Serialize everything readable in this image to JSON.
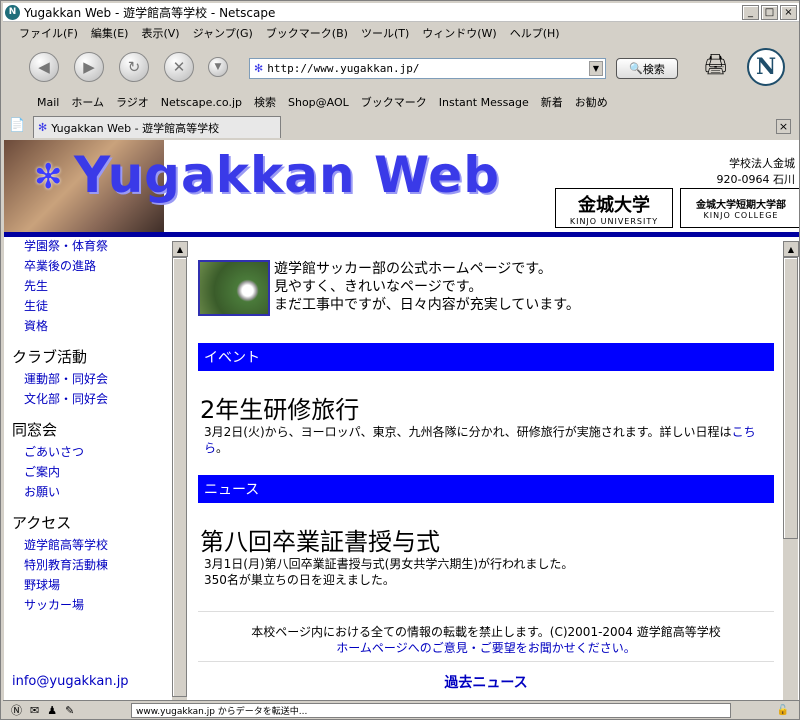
{
  "window": {
    "title": "Yugakkan Web - 遊学館高等学校 - Netscape"
  },
  "menu": [
    "ファイル(F)",
    "編集(E)",
    "表示(V)",
    "ジャンプ(G)",
    "ブックマーク(B)",
    "ツール(T)",
    "ウィンドウ(W)",
    "ヘルプ(H)"
  ],
  "nav": {
    "url": "http://www.yugakkan.jp/",
    "search_label": "検索"
  },
  "bookmarks": [
    "Mail",
    "ホーム",
    "ラジオ",
    "Netscape.co.jp",
    "検索",
    "Shop@AOL",
    "ブックマーク",
    "Instant Message",
    "新着",
    "お勧め"
  ],
  "tab": {
    "label": "Yugakkan Web - 遊学館高等学校"
  },
  "banner": {
    "title": "Yugakkan Web",
    "org": "学校法人金城",
    "postal": "920-0964 石川",
    "logo1_main": "金城大学",
    "logo1_sub": "KINJO UNIVERSITY",
    "logo2_main": "金城大学短期大学部",
    "logo2_sub": "KINJO COLLEGE"
  },
  "sidebar": {
    "items_top": [
      "学園祭・体育祭",
      "卒業後の進路",
      "先生",
      "生徒",
      "資格"
    ],
    "club_head": "クラブ活動",
    "club_items": [
      "運動部・同好会",
      "文化部・同好会"
    ],
    "alumni_head": "同窓会",
    "alumni_items": [
      "ごあいさつ",
      "ご案内",
      "お願い"
    ],
    "access_head": "アクセス",
    "access_items": [
      "遊学館高等学校",
      "特別教育活動棟",
      "野球場",
      "サッカー場"
    ],
    "email": "info@yugakkan.jp"
  },
  "main": {
    "intro": [
      "遊学館サッカー部の公式ホームページです。",
      "見やすく、きれいなページです。",
      "まだ工事中ですが、日々内容が充実しています。"
    ],
    "event_head": "イベント",
    "event_title": "2年生研修旅行",
    "event_text": "3月2日(火)から、ヨーロッパ、東京、九州各隊に分かれ、研修旅行が実施されます。詳しい日程は",
    "event_link": "こちら",
    "event_tail": "。",
    "news_head": "ニュース",
    "news_title": "第八回卒業証書授与式",
    "news_line1": "3月1日(月)第八回卒業証書授与式(男女共学六期生)が行われました。",
    "news_line2": "350名が巣立ちの日を迎えました。",
    "footer_line1": "本校ページ内における全ての情報の転載を禁止します。(C)2001-2004 遊学館高等学校",
    "footer_link": "ホームページへのご意見・ご要望をお聞かせください。",
    "past_news": "過去ニュース"
  },
  "status": {
    "text": "www.yugakkan.jp からデータを転送中..."
  }
}
